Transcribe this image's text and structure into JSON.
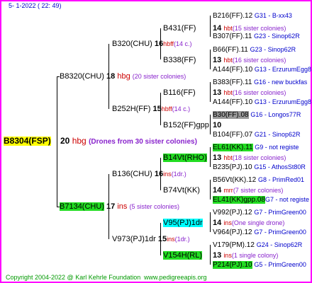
{
  "header": {
    "date": "5-  1-2022 ( 22: 49)"
  },
  "footer": {
    "copyright": "Copyright 2004-2022 @ Karl Kehrle Foundation",
    "url": "www.pedigreeapis.org"
  },
  "root": {
    "code": "B8304(FSP)",
    "num": "20",
    "hbg": "hbg",
    "note": "(Drones from 30 sister colonies)"
  },
  "gen1": [
    {
      "code": "B8320(CHU)",
      "num": "18",
      "hbg": "hbg",
      "note": "(20 sister colonies)"
    },
    {
      "code": "B7134(CHU)",
      "num": "17",
      "hbg": "ins",
      "note": "(5 sister colonies)"
    }
  ],
  "gen2": [
    {
      "code": "B320(CHU)",
      "num": "16",
      "hbg": "hbff",
      "note": "(14 c.)"
    },
    {
      "code": "B252H(FF)",
      "num": "15",
      "hbg": "hbff",
      "note": "(14 c.)"
    },
    {
      "code": "B136(CHU)",
      "num": "16",
      "hbg": "ins",
      "note": "(1dr.)"
    },
    {
      "code": "V973(PJ)1dr",
      "num": "15",
      "hbg": "ins",
      "note": "(1dr.)"
    }
  ],
  "gen3": [
    {
      "code": "B431(FF)",
      "num": "14",
      "hbg": "hbt",
      "note": "(15 sister colonies)"
    },
    {
      "code": "B338(FF)",
      "num": "13",
      "hbg": "hbt",
      "note": "(16 sister colonies)"
    },
    {
      "code": "B116(FF)",
      "num": "13",
      "hbg": "hbt",
      "note": "(16 sister colonies)"
    },
    {
      "code": "B152(FF)gpp",
      "num": "10",
      "hbg": "",
      "note": ""
    },
    {
      "code": "B14Vt(RHO)",
      "num": "13",
      "hbg": "hbt",
      "note": "(18 sister colonies)"
    },
    {
      "code": "B74Vt(KK)",
      "num": "14",
      "hbg": "mrr",
      "note": "(7 sister colonies)"
    },
    {
      "code": "V95(PJ)1dr",
      "num": "14",
      "hbg": "ins",
      "note": "(One single drone)"
    },
    {
      "code": "V154H(RL)",
      "num": "13",
      "hbg": "ins",
      "note": "(1 single colony)"
    }
  ],
  "gen4": [
    {
      "code": "B216(FF).12",
      "id": "G31 - B-xx43"
    },
    {
      "code": "B307(FF).11",
      "id": "G23 - Sinop62R"
    },
    {
      "code": "B66(FF).11",
      "id": "G23 - Sinop62R"
    },
    {
      "code": "A144(FF).10",
      "id": "G13 - ErzurumEgg8"
    },
    {
      "code": "B383(FF).11",
      "id": "G16 - new buckfas"
    },
    {
      "code": "A144(FF).10",
      "id": "G13 - ErzurumEgg8"
    },
    {
      "code": "B30(FF).08",
      "id": "G16 - Longos77R"
    },
    {
      "code": "B104(FF).07",
      "id": "G21 - Sinop62R"
    },
    {
      "code": "EL61(KK).11",
      "id": "G9 - not registe"
    },
    {
      "code": "B235(PJ).10",
      "id": "G15 - AthosSt80R"
    },
    {
      "code": "B56Vt(KK).12",
      "id": "G8 - PrimRed01"
    },
    {
      "code": "EL41(KK)gpp.08",
      "id": "G7 - not registe"
    },
    {
      "code": "V992(PJ).12",
      "id": "G7 - PrimGreen00"
    },
    {
      "code": "V964(PJ).12",
      "id": "G7 - PrimGreen00"
    },
    {
      "code": "V179(PM).12",
      "id": "G24 - Sinop62R"
    },
    {
      "code": "P214(PJ).10",
      "id": "G5 - PrimGreen00"
    }
  ]
}
